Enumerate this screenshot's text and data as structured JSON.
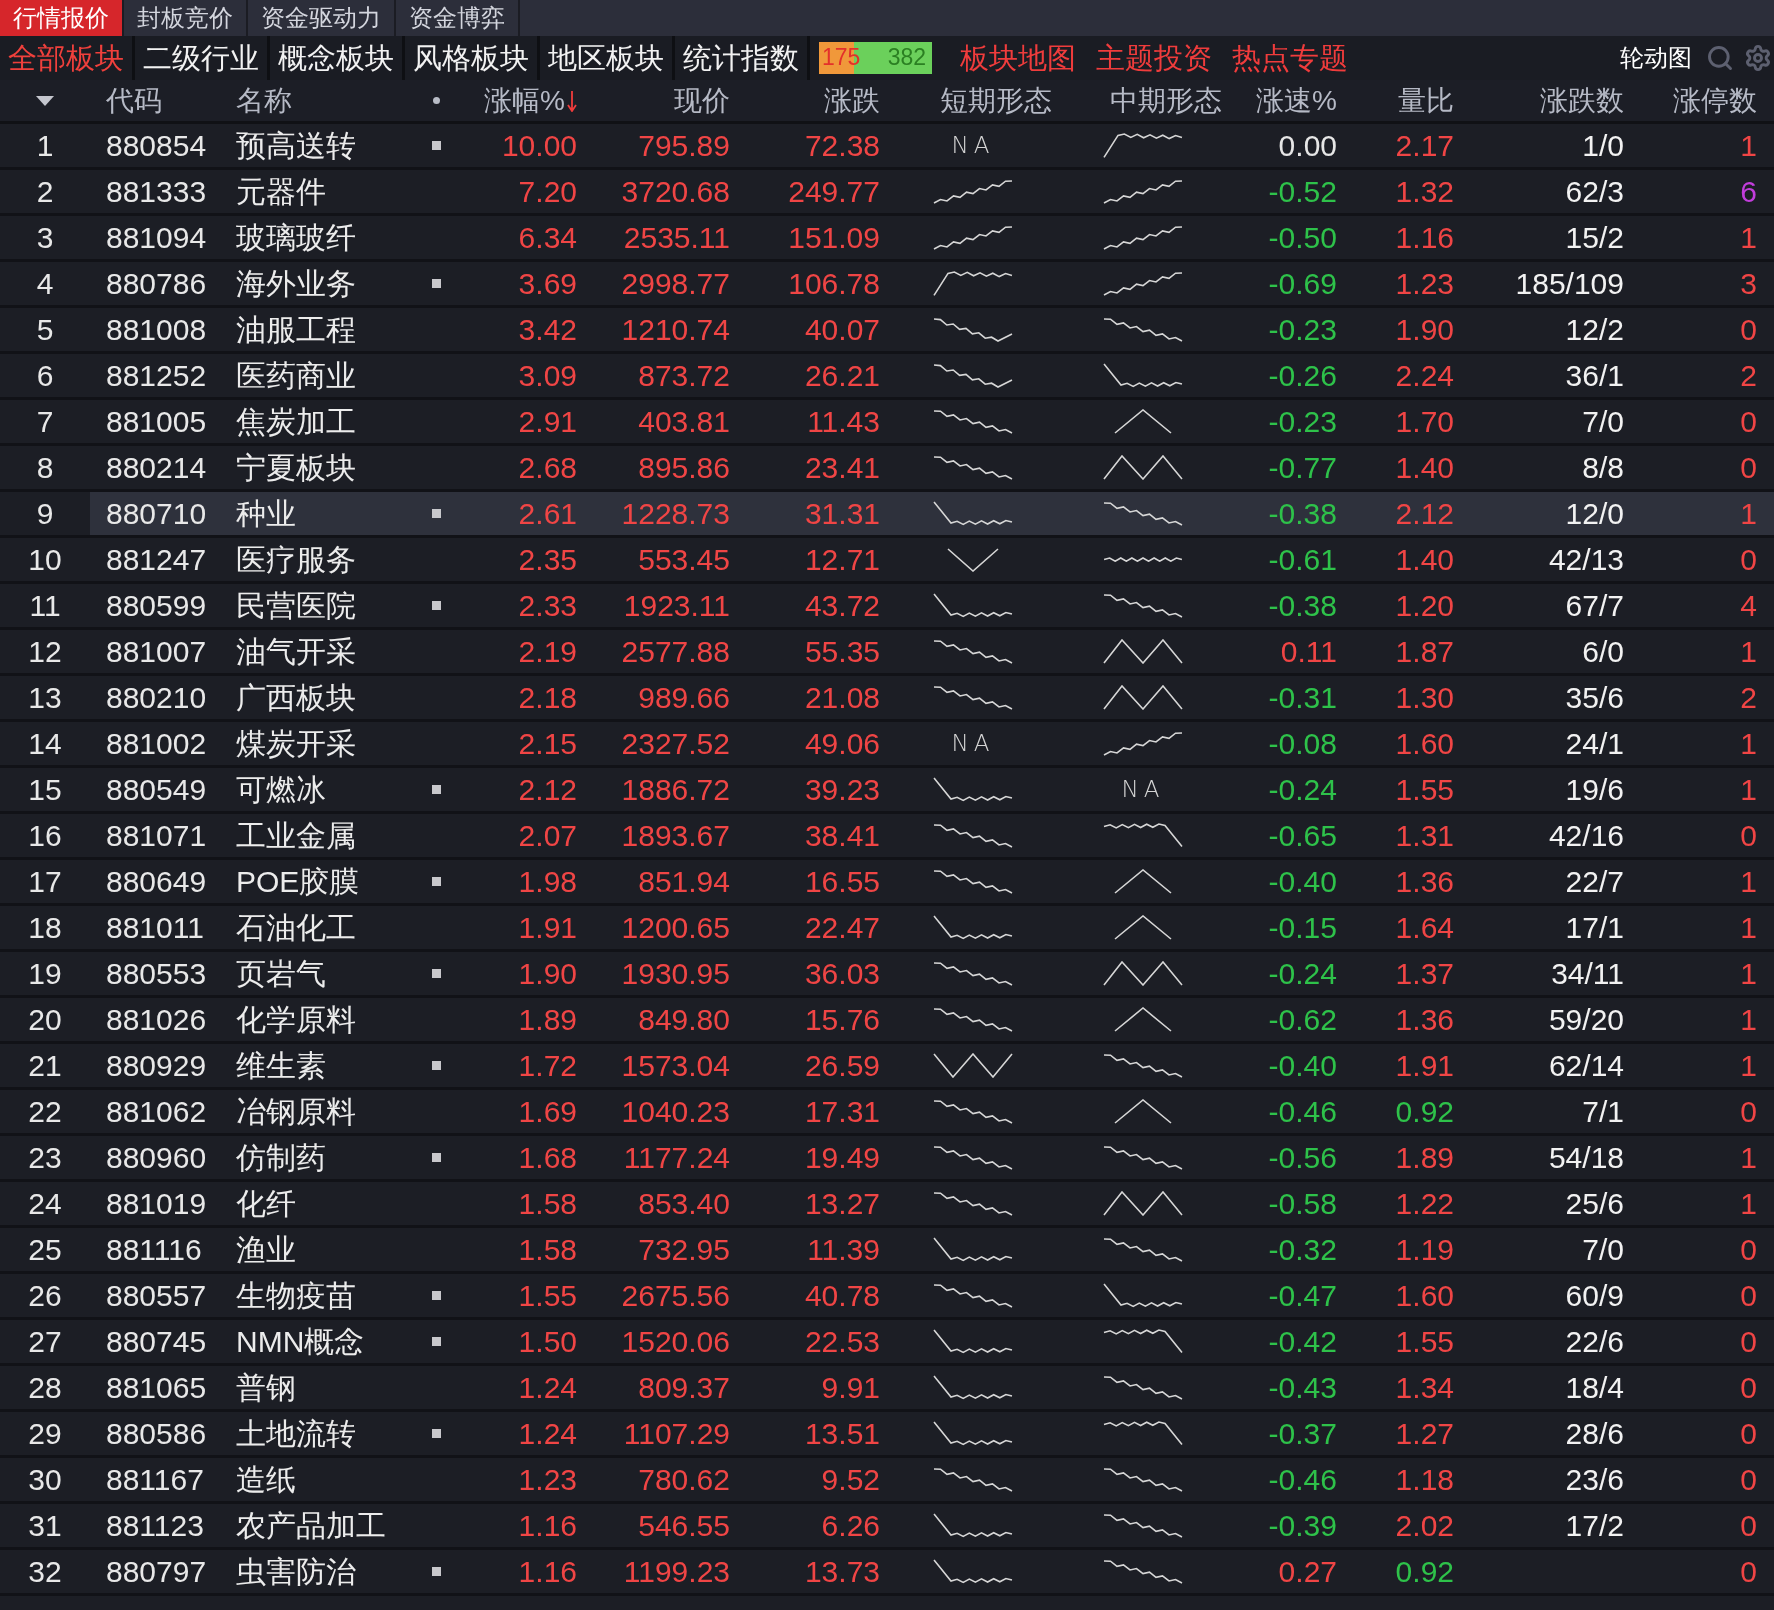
{
  "tabs": [
    {
      "label": "行情报价",
      "selected": true
    },
    {
      "label": "封板竞价",
      "selected": false
    },
    {
      "label": "资金驱动力",
      "selected": false
    },
    {
      "label": "资金博弈",
      "selected": false
    }
  ],
  "categories": [
    {
      "label": "全部板块",
      "selected": true
    },
    {
      "label": "二级行业",
      "selected": false
    },
    {
      "label": "概念板块",
      "selected": false
    },
    {
      "label": "风格板块",
      "selected": false
    },
    {
      "label": "地区板块",
      "selected": false
    },
    {
      "label": "统计指数",
      "selected": false
    }
  ],
  "market_breadth": {
    "up": "175",
    "down": "382",
    "level": 0.31
  },
  "links": [
    "板块地图",
    "主题投资",
    "热点专题"
  ],
  "tools": {
    "label": "轮动图"
  },
  "columns": [
    {
      "label": "代码",
      "sorted": false
    },
    {
      "label": "名称",
      "sorted": false
    },
    {
      "label": "涨幅%",
      "sorted": true
    },
    {
      "label": "现价",
      "sorted": false
    },
    {
      "label": "涨跌",
      "sorted": false
    },
    {
      "label": "短期形态",
      "sorted": false
    },
    {
      "label": "中期形态",
      "sorted": false
    },
    {
      "label": "涨速%",
      "sorted": false
    },
    {
      "label": "量比",
      "sorted": false
    },
    {
      "label": "涨跌数",
      "sorted": false
    },
    {
      "label": "涨停数",
      "sorted": false
    }
  ],
  "rows": [
    {
      "no": "1",
      "code": "880854",
      "name": "预高送转",
      "marked": true,
      "change_pct": "10.00",
      "price": "795.89",
      "change": "72.38",
      "short_trend": {
        "kind": "na",
        "text": "NA"
      },
      "mid_trend": {
        "kind": "plateau"
      },
      "speed": {
        "text": "0.00",
        "color": "#e6e6e6"
      },
      "volume_ratio": {
        "text": "2.17",
        "color": "#f04545"
      },
      "up_down": "1/0",
      "limit_up": {
        "text": "1",
        "color": "#f04545"
      },
      "selected": false
    },
    {
      "no": "2",
      "code": "881333",
      "name": "元器件",
      "marked": false,
      "change_pct": "7.20",
      "price": "3720.68",
      "change": "249.77",
      "short_trend": {
        "kind": "rise"
      },
      "mid_trend": {
        "kind": "rise"
      },
      "speed": {
        "text": "-0.52",
        "color": "#2ec24a"
      },
      "volume_ratio": {
        "text": "1.32",
        "color": "#f04545"
      },
      "up_down": "62/3",
      "limit_up": {
        "text": "6",
        "color": "#c23ddc"
      },
      "selected": false
    },
    {
      "no": "3",
      "code": "881094",
      "name": "玻璃玻纤",
      "marked": false,
      "change_pct": "6.34",
      "price": "2535.11",
      "change": "151.09",
      "short_trend": {
        "kind": "rise"
      },
      "mid_trend": {
        "kind": "rise"
      },
      "speed": {
        "text": "-0.50",
        "color": "#2ec24a"
      },
      "volume_ratio": {
        "text": "1.16",
        "color": "#f04545"
      },
      "up_down": "15/2",
      "limit_up": {
        "text": "1",
        "color": "#f04545"
      },
      "selected": false
    },
    {
      "no": "4",
      "code": "880786",
      "name": "海外业务",
      "marked": true,
      "change_pct": "3.69",
      "price": "2998.77",
      "change": "106.78",
      "short_trend": {
        "kind": "plateau"
      },
      "mid_trend": {
        "kind": "rise"
      },
      "speed": {
        "text": "-0.69",
        "color": "#2ec24a"
      },
      "volume_ratio": {
        "text": "1.23",
        "color": "#f04545"
      },
      "up_down": "185/109",
      "limit_up": {
        "text": "3",
        "color": "#f04545"
      },
      "selected": false
    },
    {
      "no": "5",
      "code": "881008",
      "name": "油服工程",
      "marked": false,
      "change_pct": "3.42",
      "price": "1210.74",
      "change": "40.07",
      "short_trend": {
        "kind": "fall_rebound"
      },
      "mid_trend": {
        "kind": "fall"
      },
      "speed": {
        "text": "-0.23",
        "color": "#2ec24a"
      },
      "volume_ratio": {
        "text": "1.90",
        "color": "#f04545"
      },
      "up_down": "12/2",
      "limit_up": {
        "text": "0",
        "color": "#f04545"
      },
      "selected": false
    },
    {
      "no": "6",
      "code": "881252",
      "name": "医药商业",
      "marked": false,
      "change_pct": "3.09",
      "price": "873.72",
      "change": "26.21",
      "short_trend": {
        "kind": "fall_rebound"
      },
      "mid_trend": {
        "kind": "drop_flat"
      },
      "speed": {
        "text": "-0.26",
        "color": "#2ec24a"
      },
      "volume_ratio": {
        "text": "2.24",
        "color": "#f04545"
      },
      "up_down": "36/1",
      "limit_up": {
        "text": "2",
        "color": "#f04545"
      },
      "selected": false
    },
    {
      "no": "7",
      "code": "881005",
      "name": "焦炭加工",
      "marked": false,
      "change_pct": "2.91",
      "price": "403.81",
      "change": "11.43",
      "short_trend": {
        "kind": "fall"
      },
      "mid_trend": {
        "kind": "peak"
      },
      "speed": {
        "text": "-0.23",
        "color": "#2ec24a"
      },
      "volume_ratio": {
        "text": "1.70",
        "color": "#f04545"
      },
      "up_down": "7/0",
      "limit_up": {
        "text": "0",
        "color": "#f04545"
      },
      "selected": false
    },
    {
      "no": "8",
      "code": "880214",
      "name": "宁夏板块",
      "marked": false,
      "change_pct": "2.68",
      "price": "895.86",
      "change": "23.41",
      "short_trend": {
        "kind": "fall"
      },
      "mid_trend": {
        "kind": "double_peak"
      },
      "speed": {
        "text": "-0.77",
        "color": "#2ec24a"
      },
      "volume_ratio": {
        "text": "1.40",
        "color": "#f04545"
      },
      "up_down": "8/8",
      "limit_up": {
        "text": "0",
        "color": "#f04545"
      },
      "selected": false
    },
    {
      "no": "9",
      "code": "880710",
      "name": "种业",
      "marked": true,
      "change_pct": "2.61",
      "price": "1228.73",
      "change": "31.31",
      "short_trend": {
        "kind": "drop_flat"
      },
      "mid_trend": {
        "kind": "fall"
      },
      "speed": {
        "text": "-0.38",
        "color": "#2ec24a"
      },
      "volume_ratio": {
        "text": "2.12",
        "color": "#f04545"
      },
      "up_down": "12/0",
      "limit_up": {
        "text": "1",
        "color": "#f04545"
      },
      "selected": true
    },
    {
      "no": "10",
      "code": "881247",
      "name": "医疗服务",
      "marked": false,
      "change_pct": "2.35",
      "price": "553.45",
      "change": "12.71",
      "short_trend": {
        "kind": "valley"
      },
      "mid_trend": {
        "kind": "flat"
      },
      "speed": {
        "text": "-0.61",
        "color": "#2ec24a"
      },
      "volume_ratio": {
        "text": "1.40",
        "color": "#f04545"
      },
      "up_down": "42/13",
      "limit_up": {
        "text": "0",
        "color": "#f04545"
      },
      "selected": false
    },
    {
      "no": "11",
      "code": "880599",
      "name": "民营医院",
      "marked": true,
      "change_pct": "2.33",
      "price": "1923.11",
      "change": "43.72",
      "short_trend": {
        "kind": "drop_flat"
      },
      "mid_trend": {
        "kind": "fall"
      },
      "speed": {
        "text": "-0.38",
        "color": "#2ec24a"
      },
      "volume_ratio": {
        "text": "1.20",
        "color": "#f04545"
      },
      "up_down": "67/7",
      "limit_up": {
        "text": "4",
        "color": "#f04545"
      },
      "selected": false
    },
    {
      "no": "12",
      "code": "881007",
      "name": "油气开采",
      "marked": false,
      "change_pct": "2.19",
      "price": "2577.88",
      "change": "55.35",
      "short_trend": {
        "kind": "fall"
      },
      "mid_trend": {
        "kind": "double_peak"
      },
      "speed": {
        "text": "0.11",
        "color": "#f04545"
      },
      "volume_ratio": {
        "text": "1.87",
        "color": "#f04545"
      },
      "up_down": "6/0",
      "limit_up": {
        "text": "1",
        "color": "#f04545"
      },
      "selected": false
    },
    {
      "no": "13",
      "code": "880210",
      "name": "广西板块",
      "marked": false,
      "change_pct": "2.18",
      "price": "989.66",
      "change": "21.08",
      "short_trend": {
        "kind": "fall"
      },
      "mid_trend": {
        "kind": "double_peak"
      },
      "speed": {
        "text": "-0.31",
        "color": "#2ec24a"
      },
      "volume_ratio": {
        "text": "1.30",
        "color": "#f04545"
      },
      "up_down": "35/6",
      "limit_up": {
        "text": "2",
        "color": "#f04545"
      },
      "selected": false
    },
    {
      "no": "14",
      "code": "881002",
      "name": "煤炭开采",
      "marked": false,
      "change_pct": "2.15",
      "price": "2327.52",
      "change": "49.06",
      "short_trend": {
        "kind": "na",
        "text": "NA"
      },
      "mid_trend": {
        "kind": "rise"
      },
      "speed": {
        "text": "-0.08",
        "color": "#2ec24a"
      },
      "volume_ratio": {
        "text": "1.60",
        "color": "#f04545"
      },
      "up_down": "24/1",
      "limit_up": {
        "text": "1",
        "color": "#f04545"
      },
      "selected": false
    },
    {
      "no": "15",
      "code": "880549",
      "name": "可燃冰",
      "marked": true,
      "change_pct": "2.12",
      "price": "1886.72",
      "change": "39.23",
      "short_trend": {
        "kind": "drop_flat"
      },
      "mid_trend": {
        "kind": "na",
        "text": "NA"
      },
      "speed": {
        "text": "-0.24",
        "color": "#2ec24a"
      },
      "volume_ratio": {
        "text": "1.55",
        "color": "#f04545"
      },
      "up_down": "19/6",
      "limit_up": {
        "text": "1",
        "color": "#f04545"
      },
      "selected": false
    },
    {
      "no": "16",
      "code": "881071",
      "name": "工业金属",
      "marked": false,
      "change_pct": "2.07",
      "price": "1893.67",
      "change": "38.41",
      "short_trend": {
        "kind": "fall"
      },
      "mid_trend": {
        "kind": "hump_drop"
      },
      "speed": {
        "text": "-0.65",
        "color": "#2ec24a"
      },
      "volume_ratio": {
        "text": "1.31",
        "color": "#f04545"
      },
      "up_down": "42/16",
      "limit_up": {
        "text": "0",
        "color": "#f04545"
      },
      "selected": false
    },
    {
      "no": "17",
      "code": "880649",
      "name": "POE胶膜",
      "marked": true,
      "change_pct": "1.98",
      "price": "851.94",
      "change": "16.55",
      "short_trend": {
        "kind": "fall"
      },
      "mid_trend": {
        "kind": "peak"
      },
      "speed": {
        "text": "-0.40",
        "color": "#2ec24a"
      },
      "volume_ratio": {
        "text": "1.36",
        "color": "#f04545"
      },
      "up_down": "22/7",
      "limit_up": {
        "text": "1",
        "color": "#f04545"
      },
      "selected": false
    },
    {
      "no": "18",
      "code": "881011",
      "name": "石油化工",
      "marked": false,
      "change_pct": "1.91",
      "price": "1200.65",
      "change": "22.47",
      "short_trend": {
        "kind": "drop_flat"
      },
      "mid_trend": {
        "kind": "peak"
      },
      "speed": {
        "text": "-0.15",
        "color": "#2ec24a"
      },
      "volume_ratio": {
        "text": "1.64",
        "color": "#f04545"
      },
      "up_down": "17/1",
      "limit_up": {
        "text": "1",
        "color": "#f04545"
      },
      "selected": false
    },
    {
      "no": "19",
      "code": "880553",
      "name": "页岩气",
      "marked": true,
      "change_pct": "1.90",
      "price": "1930.95",
      "change": "36.03",
      "short_trend": {
        "kind": "fall"
      },
      "mid_trend": {
        "kind": "double_peak"
      },
      "speed": {
        "text": "-0.24",
        "color": "#2ec24a"
      },
      "volume_ratio": {
        "text": "1.37",
        "color": "#f04545"
      },
      "up_down": "34/11",
      "limit_up": {
        "text": "1",
        "color": "#f04545"
      },
      "selected": false
    },
    {
      "no": "20",
      "code": "881026",
      "name": "化学原料",
      "marked": false,
      "change_pct": "1.89",
      "price": "849.80",
      "change": "15.76",
      "short_trend": {
        "kind": "fall"
      },
      "mid_trend": {
        "kind": "peak"
      },
      "speed": {
        "text": "-0.62",
        "color": "#2ec24a"
      },
      "volume_ratio": {
        "text": "1.36",
        "color": "#f04545"
      },
      "up_down": "59/20",
      "limit_up": {
        "text": "1",
        "color": "#f04545"
      },
      "selected": false
    },
    {
      "no": "21",
      "code": "880929",
      "name": "维生素",
      "marked": true,
      "change_pct": "1.72",
      "price": "1573.04",
      "change": "26.59",
      "short_trend": {
        "kind": "double_valley"
      },
      "mid_trend": {
        "kind": "fall"
      },
      "speed": {
        "text": "-0.40",
        "color": "#2ec24a"
      },
      "volume_ratio": {
        "text": "1.91",
        "color": "#f04545"
      },
      "up_down": "62/14",
      "limit_up": {
        "text": "1",
        "color": "#f04545"
      },
      "selected": false
    },
    {
      "no": "22",
      "code": "881062",
      "name": "冶钢原料",
      "marked": false,
      "change_pct": "1.69",
      "price": "1040.23",
      "change": "17.31",
      "short_trend": {
        "kind": "fall"
      },
      "mid_trend": {
        "kind": "peak"
      },
      "speed": {
        "text": "-0.46",
        "color": "#2ec24a"
      },
      "volume_ratio": {
        "text": "0.92",
        "color": "#2ec24a"
      },
      "up_down": "7/1",
      "limit_up": {
        "text": "0",
        "color": "#f04545"
      },
      "selected": false
    },
    {
      "no": "23",
      "code": "880960",
      "name": "仿制药",
      "marked": true,
      "change_pct": "1.68",
      "price": "1177.24",
      "change": "19.49",
      "short_trend": {
        "kind": "fall"
      },
      "mid_trend": {
        "kind": "fall"
      },
      "speed": {
        "text": "-0.56",
        "color": "#2ec24a"
      },
      "volume_ratio": {
        "text": "1.89",
        "color": "#f04545"
      },
      "up_down": "54/18",
      "limit_up": {
        "text": "1",
        "color": "#f04545"
      },
      "selected": false
    },
    {
      "no": "24",
      "code": "881019",
      "name": "化纤",
      "marked": false,
      "change_pct": "1.58",
      "price": "853.40",
      "change": "13.27",
      "short_trend": {
        "kind": "fall"
      },
      "mid_trend": {
        "kind": "double_peak"
      },
      "speed": {
        "text": "-0.58",
        "color": "#2ec24a"
      },
      "volume_ratio": {
        "text": "1.22",
        "color": "#f04545"
      },
      "up_down": "25/6",
      "limit_up": {
        "text": "1",
        "color": "#f04545"
      },
      "selected": false
    },
    {
      "no": "25",
      "code": "881116",
      "name": "渔业",
      "marked": false,
      "change_pct": "1.58",
      "price": "732.95",
      "change": "11.39",
      "short_trend": {
        "kind": "drop_flat"
      },
      "mid_trend": {
        "kind": "fall"
      },
      "speed": {
        "text": "-0.32",
        "color": "#2ec24a"
      },
      "volume_ratio": {
        "text": "1.19",
        "color": "#f04545"
      },
      "up_down": "7/0",
      "limit_up": {
        "text": "0",
        "color": "#f04545"
      },
      "selected": false
    },
    {
      "no": "26",
      "code": "880557",
      "name": "生物疫苗",
      "marked": true,
      "change_pct": "1.55",
      "price": "2675.56",
      "change": "40.78",
      "short_trend": {
        "kind": "fall"
      },
      "mid_trend": {
        "kind": "drop_flat"
      },
      "speed": {
        "text": "-0.47",
        "color": "#2ec24a"
      },
      "volume_ratio": {
        "text": "1.60",
        "color": "#f04545"
      },
      "up_down": "60/9",
      "limit_up": {
        "text": "0",
        "color": "#f04545"
      },
      "selected": false
    },
    {
      "no": "27",
      "code": "880745",
      "name": "NMN概念",
      "marked": true,
      "change_pct": "1.50",
      "price": "1520.06",
      "change": "22.53",
      "short_trend": {
        "kind": "drop_flat"
      },
      "mid_trend": {
        "kind": "hump_drop"
      },
      "speed": {
        "text": "-0.42",
        "color": "#2ec24a"
      },
      "volume_ratio": {
        "text": "1.55",
        "color": "#f04545"
      },
      "up_down": "22/6",
      "limit_up": {
        "text": "0",
        "color": "#f04545"
      },
      "selected": false
    },
    {
      "no": "28",
      "code": "881065",
      "name": "普钢",
      "marked": false,
      "change_pct": "1.24",
      "price": "809.37",
      "change": "9.91",
      "short_trend": {
        "kind": "drop_flat"
      },
      "mid_trend": {
        "kind": "fall"
      },
      "speed": {
        "text": "-0.43",
        "color": "#2ec24a"
      },
      "volume_ratio": {
        "text": "1.34",
        "color": "#f04545"
      },
      "up_down": "18/4",
      "limit_up": {
        "text": "0",
        "color": "#f04545"
      },
      "selected": false
    },
    {
      "no": "29",
      "code": "880586",
      "name": "土地流转",
      "marked": true,
      "change_pct": "1.24",
      "price": "1107.29",
      "change": "13.51",
      "short_trend": {
        "kind": "drop_flat"
      },
      "mid_trend": {
        "kind": "hump_drop"
      },
      "speed": {
        "text": "-0.37",
        "color": "#2ec24a"
      },
      "volume_ratio": {
        "text": "1.27",
        "color": "#f04545"
      },
      "up_down": "28/6",
      "limit_up": {
        "text": "0",
        "color": "#f04545"
      },
      "selected": false
    },
    {
      "no": "30",
      "code": "881167",
      "name": "造纸",
      "marked": false,
      "change_pct": "1.23",
      "price": "780.62",
      "change": "9.52",
      "short_trend": {
        "kind": "fall"
      },
      "mid_trend": {
        "kind": "fall"
      },
      "speed": {
        "text": "-0.46",
        "color": "#2ec24a"
      },
      "volume_ratio": {
        "text": "1.18",
        "color": "#f04545"
      },
      "up_down": "23/6",
      "limit_up": {
        "text": "0",
        "color": "#f04545"
      },
      "selected": false
    },
    {
      "no": "31",
      "code": "881123",
      "name": "农产品加工",
      "marked": false,
      "change_pct": "1.16",
      "price": "546.55",
      "change": "6.26",
      "short_trend": {
        "kind": "drop_flat"
      },
      "mid_trend": {
        "kind": "fall"
      },
      "speed": {
        "text": "-0.39",
        "color": "#2ec24a"
      },
      "volume_ratio": {
        "text": "2.02",
        "color": "#f04545"
      },
      "up_down": "17/2",
      "limit_up": {
        "text": "0",
        "color": "#f04545"
      },
      "selected": false
    },
    {
      "no": "32",
      "code": "880797",
      "name": "虫害防治",
      "marked": true,
      "change_pct": "1.16",
      "price": "1199.23",
      "change": "13.73",
      "short_trend": {
        "kind": "drop_flat"
      },
      "mid_trend": {
        "kind": "fall"
      },
      "speed": {
        "text": "0.27",
        "color": "#f04545"
      },
      "volume_ratio": {
        "text": "0.92",
        "color": "#2ec24a"
      },
      "limit_up": {
        "text": "0",
        "color": "#f04545"
      },
      "selected": false
    }
  ]
}
